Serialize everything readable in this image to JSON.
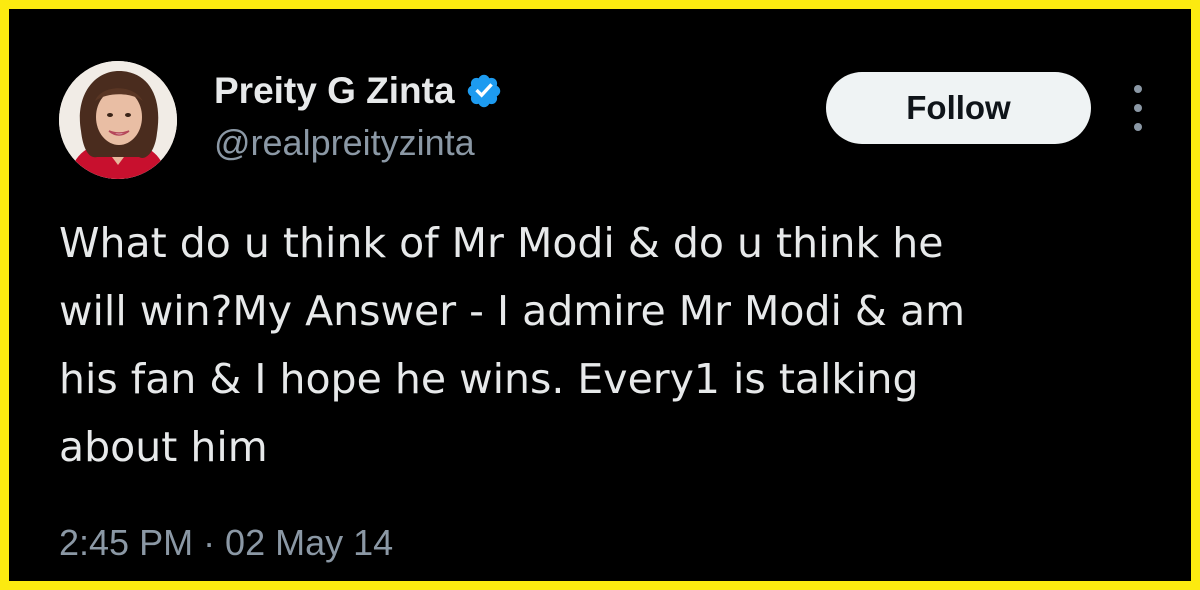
{
  "author": {
    "display_name": "Preity G Zinta",
    "handle": "@realpreityzinta",
    "verified": true,
    "avatar_icon": "profile-photo"
  },
  "actions": {
    "follow_label": "Follow",
    "more_icon": "vertical-ellipsis-icon"
  },
  "tweet": {
    "text": "What do u think of Mr Modi & do u think he\nwill win?My Answer - I admire Mr Modi & am\nhis fan & I hope he wins. Every1 is talking\nabout him",
    "timestamp": "2:45 PM · 02 May 14"
  },
  "colors": {
    "frame_border": "#fcea10",
    "background": "#000000",
    "primary_text": "#e7e9ea",
    "secondary_text": "#8b98a5",
    "verified_badge": "#1d9bf0",
    "follow_button_bg": "#eff3f4"
  }
}
